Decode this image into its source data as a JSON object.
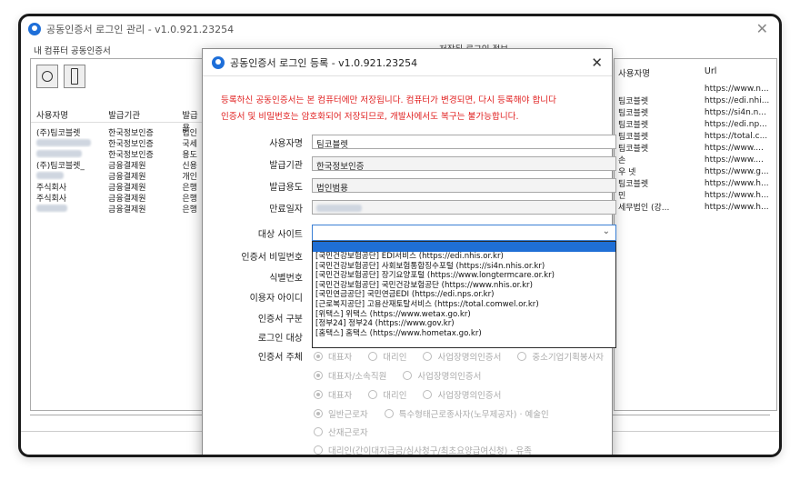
{
  "window": {
    "title": "공동인증서 로그인 관리 - v1.0.921.23254",
    "left_group_label": "내 컴퓨터 공동인증서",
    "right_group_label": "저장된 로그인 정보"
  },
  "cert_list": {
    "headers": [
      "사용자명",
      "발급기관",
      "발급용"
    ],
    "rows": [
      {
        "user": "(주)팀코블렛",
        "issuer": "한국정보인증",
        "usage": "법인"
      },
      {
        "user": "",
        "issuer": "한국정보인증",
        "usage": "국세"
      },
      {
        "user": "",
        "issuer": "한국정보인증",
        "usage": "용도"
      },
      {
        "user": "(주)팀코블렛_",
        "issuer": "금융결제원",
        "usage": "신용"
      },
      {
        "user": "",
        "issuer": "금융결제원",
        "usage": "개인"
      },
      {
        "user": "주식회사",
        "issuer": "금융결제원",
        "usage": "은행"
      },
      {
        "user": "주식회사",
        "issuer": "금융결제원",
        "usage": "은행"
      },
      {
        "user": "",
        "issuer": "금융결제원",
        "usage": "은행"
      }
    ]
  },
  "saved_list": {
    "headers": [
      "사용자명",
      "Url"
    ],
    "rows": [
      {
        "user": "",
        "url": "https://www.n..."
      },
      {
        "user": "팀코블렛",
        "url": "https://edi.nhi..."
      },
      {
        "user": "팀코블렛",
        "url": "https://si4n.n..."
      },
      {
        "user": "팀코블렛",
        "url": "https://edi.np..."
      },
      {
        "user": "팀코블렛",
        "url": "https://total.c..."
      },
      {
        "user": "팀코블렛",
        "url": "https://www...."
      },
      {
        "user": "손",
        "url": "https://www...."
      },
      {
        "user": "우 넷",
        "url": "https://www.g..."
      },
      {
        "user": "팀코블렛",
        "url": "https://www.h..."
      },
      {
        "user": "민",
        "url": "https://www.h..."
      },
      {
        "user": "세무법인 (강...",
        "url": "https://www.h..."
      }
    ]
  },
  "modal": {
    "title": "공동인증서 로그인 등록 - v1.0.921.23254",
    "notice1": "등록하신 공동인증서는 본 컴퓨터에만 저장됩니다. 컴퓨터가 변경되면, 다시 등록해야 합니다",
    "notice2": "인증서 및 비밀번호는 암호화되어 저장되므로, 개발사에서도 복구는 불가능합니다.",
    "fields": {
      "user_label": "사용자명",
      "user_value": "팀코블렛",
      "issuer_label": "발급기관",
      "issuer_value": "한국정보인증",
      "usage_label": "발급용도",
      "usage_value": "법인범용",
      "expiry_label": "만료일자",
      "expiry_value": "",
      "site_label": "대상 사이트",
      "cert_pw_label": "인증서 비밀번호",
      "id_no_label": "식별번호",
      "user_id_label": "이용자 아이디",
      "cert_type_label": "인증서 구분",
      "login_target_label": "로그인 대상",
      "cert_owner_label": "인증서 주체"
    },
    "dropdown_items": [
      "[국민건강보험공단] EDI서비스 (https://edi.nhis.or.kr)",
      "[국민건강보험공단] 사회보험통합징수포털 (https://si4n.nhis.or.kr)",
      "[국민건강보험공단] 장기요양포털 (https://www.longtermcare.or.kr)",
      "[국민건강보험공단] 국민건강보험공단 (https://www.nhis.or.kr)",
      "[국민연금공단] 국민연금EDI (https://edi.nps.or.kr)",
      "[근로복지공단] 고용산재토탈서비스 (https://total.comwel.or.kr)",
      "[위택스] 위택스 (https://www.wetax.go.kr)",
      "[정부24] 정부24 (https://www.gov.kr)",
      "[홈택스] 홈택스 (https://www.hometax.go.kr)"
    ],
    "radios": {
      "row1": [
        "대표자",
        "대리인",
        "사업장명의인증서",
        "중소기업기획봉사자"
      ],
      "row2": [
        "대표자/소속직원",
        "사업장명의인증서"
      ],
      "row3": [
        "대표자",
        "대리인",
        "사업장명의인증서"
      ],
      "row4": [
        "일반근로자",
        "특수형태근로종사자(노무제공자) · 예술인"
      ],
      "row5": [
        "산재근로자"
      ],
      "row6": [
        "대리인(간이대지급금/심사청구/최초요양급여신청) · 유족"
      ]
    }
  }
}
